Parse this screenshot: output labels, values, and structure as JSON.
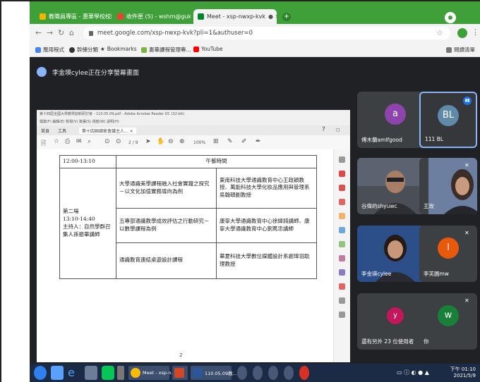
{
  "browser": {
    "tabs": [
      {
        "label": "教職員專區 - 惠華學校校園主人 |"
      },
      {
        "label": "收件匣 (5) - wshm@gukn.edu"
      },
      {
        "label": "Meet - xsp-nwxp-kvk"
      }
    ],
    "url": "meet.google.com/xsp-nwxp-kvk?pli=1&authuser=0",
    "bookmarks": [
      {
        "label": "應用程式"
      },
      {
        "label": "幹練分類"
      },
      {
        "label": "Bookmarks"
      },
      {
        "label": "惠華課程管理專..."
      },
      {
        "label": "YouTube"
      }
    ],
    "reading_list": "閱讀清單"
  },
  "meet": {
    "presenting_banner": "李金瑛cylee正在分享螢幕畫面",
    "participants": [
      {
        "name": "傅木蘭amlfgood",
        "initial": "a"
      },
      {
        "name": "111 BL",
        "initial": "BL"
      },
      {
        "name": "谷偉的shyuwc",
        "initial": ""
      },
      {
        "name": "王玫",
        "initial": ""
      },
      {
        "name": "李金瑛cylee",
        "initial": ""
      },
      {
        "name": "李芙圓mw",
        "initial": "l"
      },
      {
        "name": "還有另外 23 位使用者",
        "initial": "y"
      },
      {
        "name": "你",
        "initial": "w"
      }
    ]
  },
  "acrobat": {
    "title": "第十四屆全國大學教學創新研討會 - 110.05.09.pdf - Adobe Acrobat Reader DC (32-bit)",
    "menu": "檔案(F)  編輯(E)  檢視(V)  簽署(S)  視窗(W)  說明(H)",
    "tabs": [
      "首頁",
      "工具",
      "第十四屆國家會議主人... ×"
    ],
    "zoom": "100%",
    "page": "2",
    "table": {
      "lunch_time": "12:00-13:10",
      "lunch_label": "午餐時間",
      "session_label": "第二場",
      "session_time": "13:10-14:40",
      "session_host": "主持人：自然學群召集人孫振華講師",
      "rows": [
        {
          "topic": "大學通識美學課程融入社會實踐之探究－以文化加值實務導向為例",
          "speaker": "東南科技大學通識教育中心王政穎教授、萬能科技大學化妝品應用與管理系吳翰碩副教授"
        },
        {
          "topic": "五專部通識教學成效評估之行動研究－以數學課程為例",
          "speaker": "康寧大學通識教育中心徐緯錡講師、康寧大學通識教育中心劉篤忠講師"
        },
        {
          "topic": "通識教育連結桌遊設計課程",
          "speaker": "華夏科技大學數位媒體設計系謝瑋羽助理教授"
        }
      ]
    }
  },
  "taskbar": {
    "apps": [
      {
        "label": "Meet - xsp-n..."
      },
      {
        "label": ""
      },
      {
        "label": "110.05.09教..."
      }
    ],
    "time": "下午 01:10",
    "date": "2021/5/9"
  }
}
